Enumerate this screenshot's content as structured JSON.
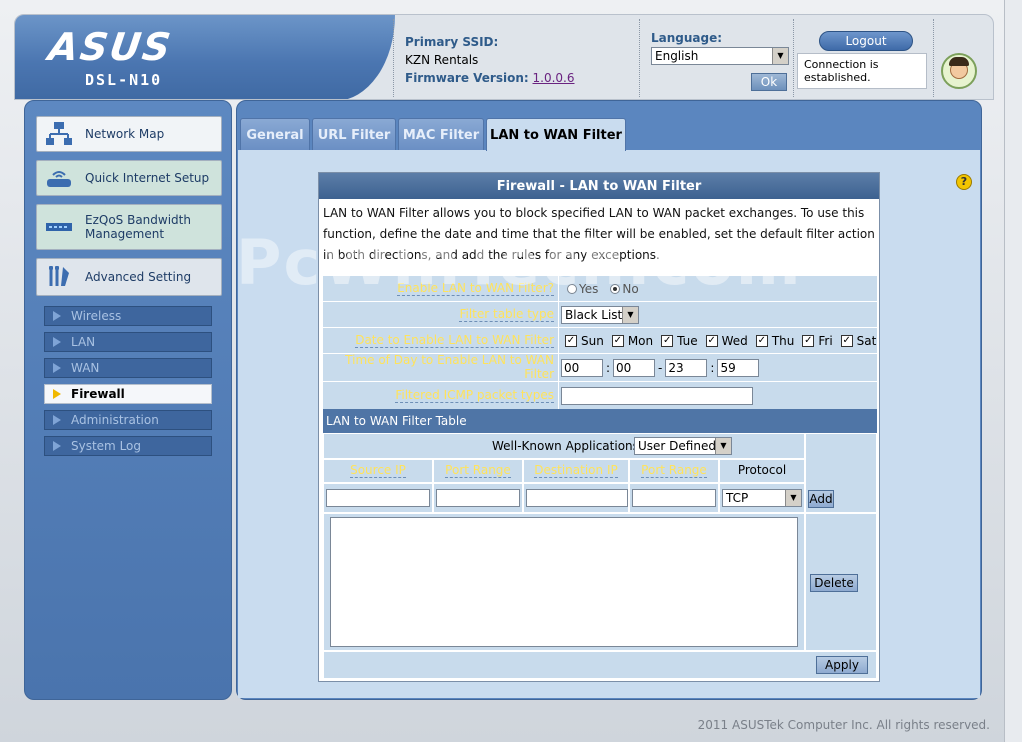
{
  "header": {
    "logo": "ASUS",
    "model": "DSL-N10",
    "ssid_label": "Primary SSID:",
    "ssid_value": "KZN Rentals",
    "firmware_label": "Firmware Version:",
    "firmware_value": "1.0.0.6",
    "language_label": "Language:",
    "language_selected": "English",
    "ok_label": "Ok",
    "logout_label": "Logout",
    "connection_status": "Connection is established."
  },
  "sidebar": {
    "main_items": [
      {
        "label": "Network Map",
        "icon": "network-map-icon"
      },
      {
        "label": "Quick Internet Setup",
        "icon": "router-icon"
      },
      {
        "label": "EzQoS Bandwidth Management",
        "icon": "qos-icon"
      },
      {
        "label": "Advanced Setting",
        "icon": "wrench-icon"
      }
    ],
    "sub_items": [
      {
        "label": "Wireless"
      },
      {
        "label": "LAN"
      },
      {
        "label": "WAN"
      },
      {
        "label": "Firewall"
      },
      {
        "label": "Administration"
      },
      {
        "label": "System Log"
      }
    ]
  },
  "tabs": [
    {
      "label": "General"
    },
    {
      "label": "URL Filter"
    },
    {
      "label": "MAC Filter"
    },
    {
      "label": "LAN to WAN Filter"
    }
  ],
  "panel": {
    "title": "Firewall - LAN to WAN Filter",
    "description": "LAN to WAN Filter allows you to block specified LAN to WAN packet exchanges. To use this function, define the date and time that the filter will be enabled, set the default filter action in both directions, and add the rules for any exceptions.",
    "enable_label": "Enable LAN to WAN Filter?",
    "yes_label": "Yes",
    "no_label": "No",
    "filter_type_label": "Filter table type",
    "filter_type_value": "Black List",
    "date_label": "Date to Enable LAN to WAN Filter",
    "days": [
      "Sun",
      "Mon",
      "Tue",
      "Wed",
      "Thu",
      "Fri",
      "Sat"
    ],
    "check_mark": "✓",
    "time_label": "Time of Day to Enable LAN to WAN Filter",
    "time_start_h": "00",
    "time_start_m": "00",
    "time_end_h": "23",
    "time_end_m": "59",
    "colon": ":",
    "dash": "-",
    "icmp_label": "Filtered ICMP packet types",
    "icmp_value": "",
    "table_title": "LAN to WAN Filter Table",
    "well_known_label": "Well-Known Applications",
    "well_known_value": "User Defined",
    "col_source_ip": "Source IP",
    "col_port_range": "Port Range",
    "col_dest_ip": "Destination IP",
    "col_port_range2": "Port Range",
    "col_protocol": "Protocol",
    "protocol_value": "TCP",
    "add_label": "Add",
    "delete_label": "Delete",
    "apply_label": "Apply"
  },
  "help_icon": "?",
  "watermark": "PcWinTech.com",
  "footer": "2011 ASUSTek Computer Inc. All rights reserved."
}
